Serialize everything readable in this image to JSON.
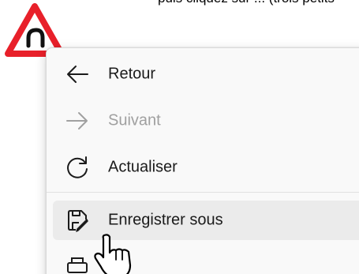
{
  "page": {
    "background_text": "puis cliquez sur ... (trois petits"
  },
  "context_menu": {
    "items": [
      {
        "label": "Retour",
        "icon": "arrow-left-icon",
        "enabled": true
      },
      {
        "label": "Suivant",
        "icon": "arrow-right-icon",
        "enabled": false
      },
      {
        "label": "Actualiser",
        "icon": "refresh-icon",
        "enabled": true
      },
      {
        "label": "Enregistrer sous",
        "icon": "save-as-icon",
        "enabled": true,
        "highlighted": true
      }
    ]
  },
  "colors": {
    "warning_red": "#e8202a",
    "menu_background": "#f9f9f9",
    "hover_background": "#ebebeb",
    "disabled_text": "#a0a0a0"
  }
}
